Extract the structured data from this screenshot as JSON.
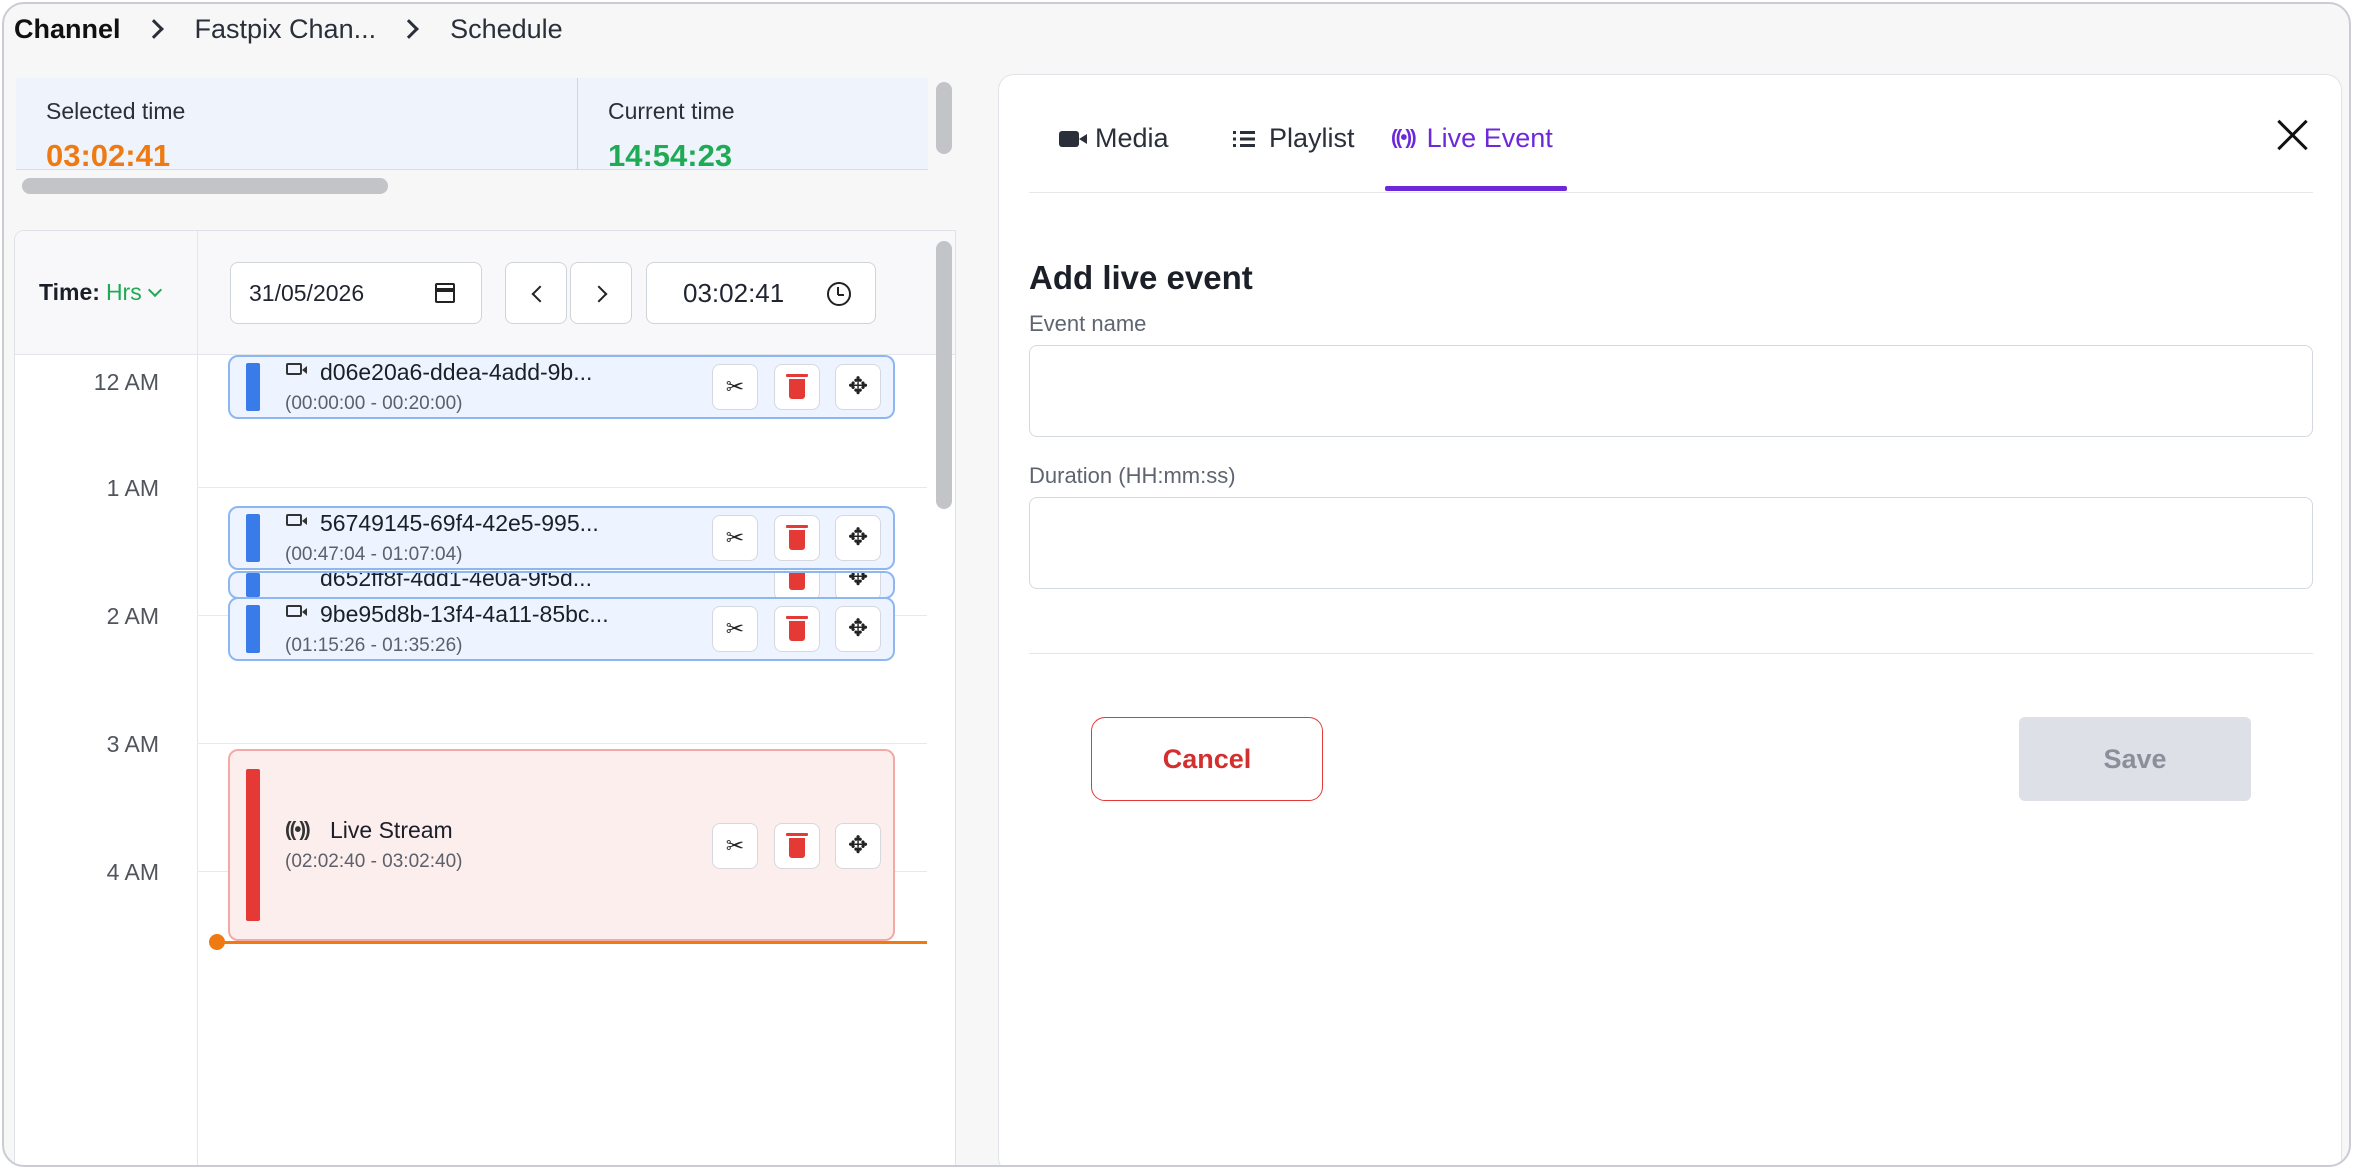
{
  "breadcrumb": [
    "Channel",
    "Fastpix Chan...",
    "Schedule"
  ],
  "time_bar": {
    "selected_label": "Selected time",
    "selected_value": "03:02:41",
    "current_label": "Current time",
    "current_value": "14:54:23"
  },
  "schedule": {
    "time_label": "Time:",
    "time_unit": "Hrs",
    "date": "31/05/2026",
    "time": "03:02:41",
    "hours": [
      "12 AM",
      "1 AM",
      "2 AM",
      "3 AM",
      "4 AM"
    ],
    "events": [
      {
        "title": "d06e20a6-ddea-4add-9b...",
        "range": "(00:00:00 - 00:20:00)",
        "type": "media"
      },
      {
        "title": "56749145-69f4-42e5-995...",
        "range": "(00:47:04 - 01:07:04)",
        "type": "media"
      },
      {
        "title": "d652ff8f-4dd1-4e0a-9f5d...",
        "range": "",
        "type": "media"
      },
      {
        "title": "9be95d8b-13f4-4a11-85bc...",
        "range": "(01:15:26 - 01:35:26)",
        "type": "media"
      },
      {
        "title": "Live Stream",
        "range": "(02:02:40 - 03:02:40)",
        "type": "live"
      }
    ]
  },
  "panel": {
    "tabs": [
      {
        "label": "Media",
        "icon": "video-camera-icon"
      },
      {
        "label": "Playlist",
        "icon": "list-icon"
      },
      {
        "label": "Live Event",
        "icon": "broadcast-icon",
        "active": true
      }
    ],
    "form_title": "Add live event",
    "event_name_label": "Event name",
    "event_name_value": "",
    "duration_label": "Duration (HH:mm:ss)",
    "duration_value": "",
    "cancel_label": "Cancel",
    "save_label": "Save"
  },
  "colors": {
    "accent_purple": "#6d28d9",
    "selected_time": "#f07a12",
    "current_time": "#1faa55",
    "media_event": "#3a7bea",
    "live_event": "#e53935"
  }
}
